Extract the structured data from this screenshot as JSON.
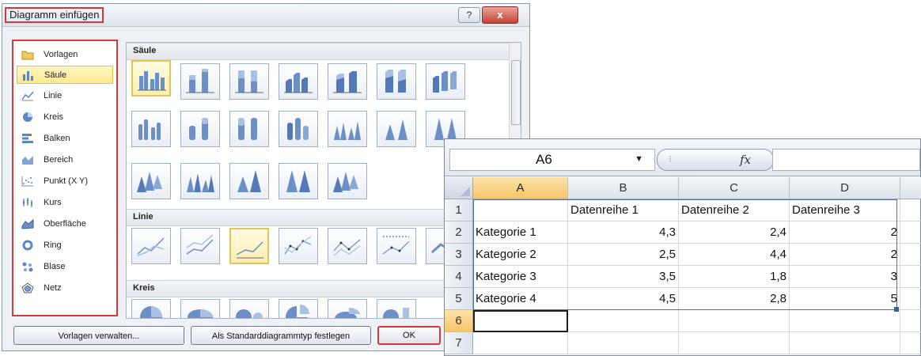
{
  "dialog": {
    "title": "Diagramm einfügen",
    "help_glyph": "?",
    "close_glyph": "x",
    "types": [
      {
        "label": "Vorlagen",
        "icon": "folder-icon",
        "selected": false
      },
      {
        "label": "Säule",
        "icon": "column-chart-icon",
        "selected": true
      },
      {
        "label": "Linie",
        "icon": "line-chart-icon",
        "selected": false
      },
      {
        "label": "Kreis",
        "icon": "pie-chart-icon",
        "selected": false
      },
      {
        "label": "Balken",
        "icon": "bar-chart-icon",
        "selected": false
      },
      {
        "label": "Bereich",
        "icon": "area-chart-icon",
        "selected": false
      },
      {
        "label": "Punkt (X Y)",
        "icon": "scatter-chart-icon",
        "selected": false
      },
      {
        "label": "Kurs",
        "icon": "stock-chart-icon",
        "selected": false
      },
      {
        "label": "Oberfläche",
        "icon": "surface-chart-icon",
        "selected": false
      },
      {
        "label": "Ring",
        "icon": "doughnut-chart-icon",
        "selected": false
      },
      {
        "label": "Blase",
        "icon": "bubble-chart-icon",
        "selected": false
      },
      {
        "label": "Netz",
        "icon": "radar-chart-icon",
        "selected": false
      }
    ],
    "sections": {
      "column": "Säule",
      "line": "Linie",
      "pie": "Kreis"
    },
    "buttons": {
      "manage_templates": "Vorlagen verwalten...",
      "set_default": "Als Standarddiagrammtyp festlegen",
      "ok": "OK"
    },
    "colors": {
      "highlight_border": "#d43a3a",
      "selection": "#fde995"
    }
  },
  "spreadsheet": {
    "name_box": "A6",
    "name_box_arrow": "▼",
    "fx_label": "fx",
    "formula_value": "",
    "columns": [
      "A",
      "B",
      "C",
      "D"
    ],
    "rows": [
      "1",
      "2",
      "3",
      "4",
      "5",
      "6",
      "7"
    ],
    "cells": [
      [
        "",
        "Datenreihe 1",
        "Datenreihe 2",
        "Datenreihe 3"
      ],
      [
        "Kategorie 1",
        "4,3",
        "2,4",
        "2"
      ],
      [
        "Kategorie 2",
        "2,5",
        "4,4",
        "2"
      ],
      [
        "Kategorie 3",
        "3,5",
        "1,8",
        "3"
      ],
      [
        "Kategorie 4",
        "4,5",
        "2,8",
        "5"
      ],
      [
        "",
        "",
        "",
        ""
      ],
      [
        "",
        "",
        "",
        ""
      ]
    ],
    "active_cell": "A6"
  }
}
